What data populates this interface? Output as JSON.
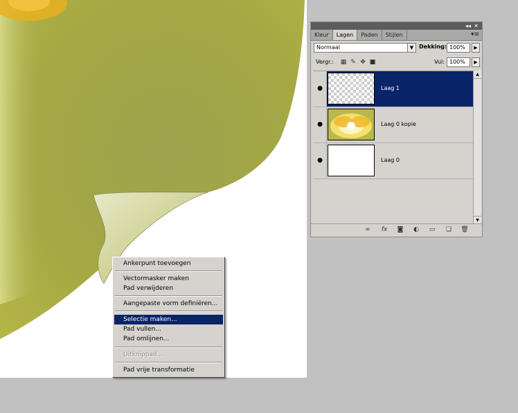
{
  "panel": {
    "tabs": [
      "Kleur",
      "Lagen",
      "Paden",
      "Stijlen"
    ],
    "active_tab": "Lagen",
    "collapse_glyph": "◂◂",
    "close_glyph": "✕",
    "menu_glyph": "▾≡",
    "blend_mode": "Normaal",
    "opacity_label": "Dekking:",
    "opacity_value": "100%",
    "lock_label": "Vergr.:",
    "fill_label": "Vul:",
    "fill_value": "100%",
    "layers": [
      {
        "name": "Laag 1",
        "selected": true,
        "thumb": "transparent"
      },
      {
        "name": "Laag 0 kopie",
        "selected": false,
        "thumb": "flower"
      },
      {
        "name": "Laag 0",
        "selected": false,
        "thumb": "white"
      }
    ],
    "bottom_icons": [
      "link-icon",
      "fx-icon",
      "mask-icon",
      "adjustment-icon",
      "folder-icon",
      "new-layer-icon",
      "trash-icon"
    ]
  },
  "context_menu": {
    "items": [
      {
        "label": "Ankerpunt toevoegen",
        "state": "normal"
      },
      {
        "label": "Vectormasker maken",
        "state": "normal"
      },
      {
        "label": "Pad verwijderen",
        "state": "normal"
      },
      {
        "label": "Aangepaste vorm definiëren...",
        "state": "normal"
      },
      {
        "label": "Selectie maken...",
        "state": "highlight"
      },
      {
        "label": "Pad vullen...",
        "state": "normal"
      },
      {
        "label": "Pad omlijnen...",
        "state": "normal"
      },
      {
        "label": "Uitknippad...",
        "state": "disabled"
      },
      {
        "label": "Pad vrije transformatie",
        "state": "normal"
      }
    ]
  },
  "colors": {
    "selection": "#0a246a",
    "panel_bg": "#d6d3ce",
    "workspace_bg": "#c1c1c1",
    "photo_green": "#9aa13c"
  }
}
